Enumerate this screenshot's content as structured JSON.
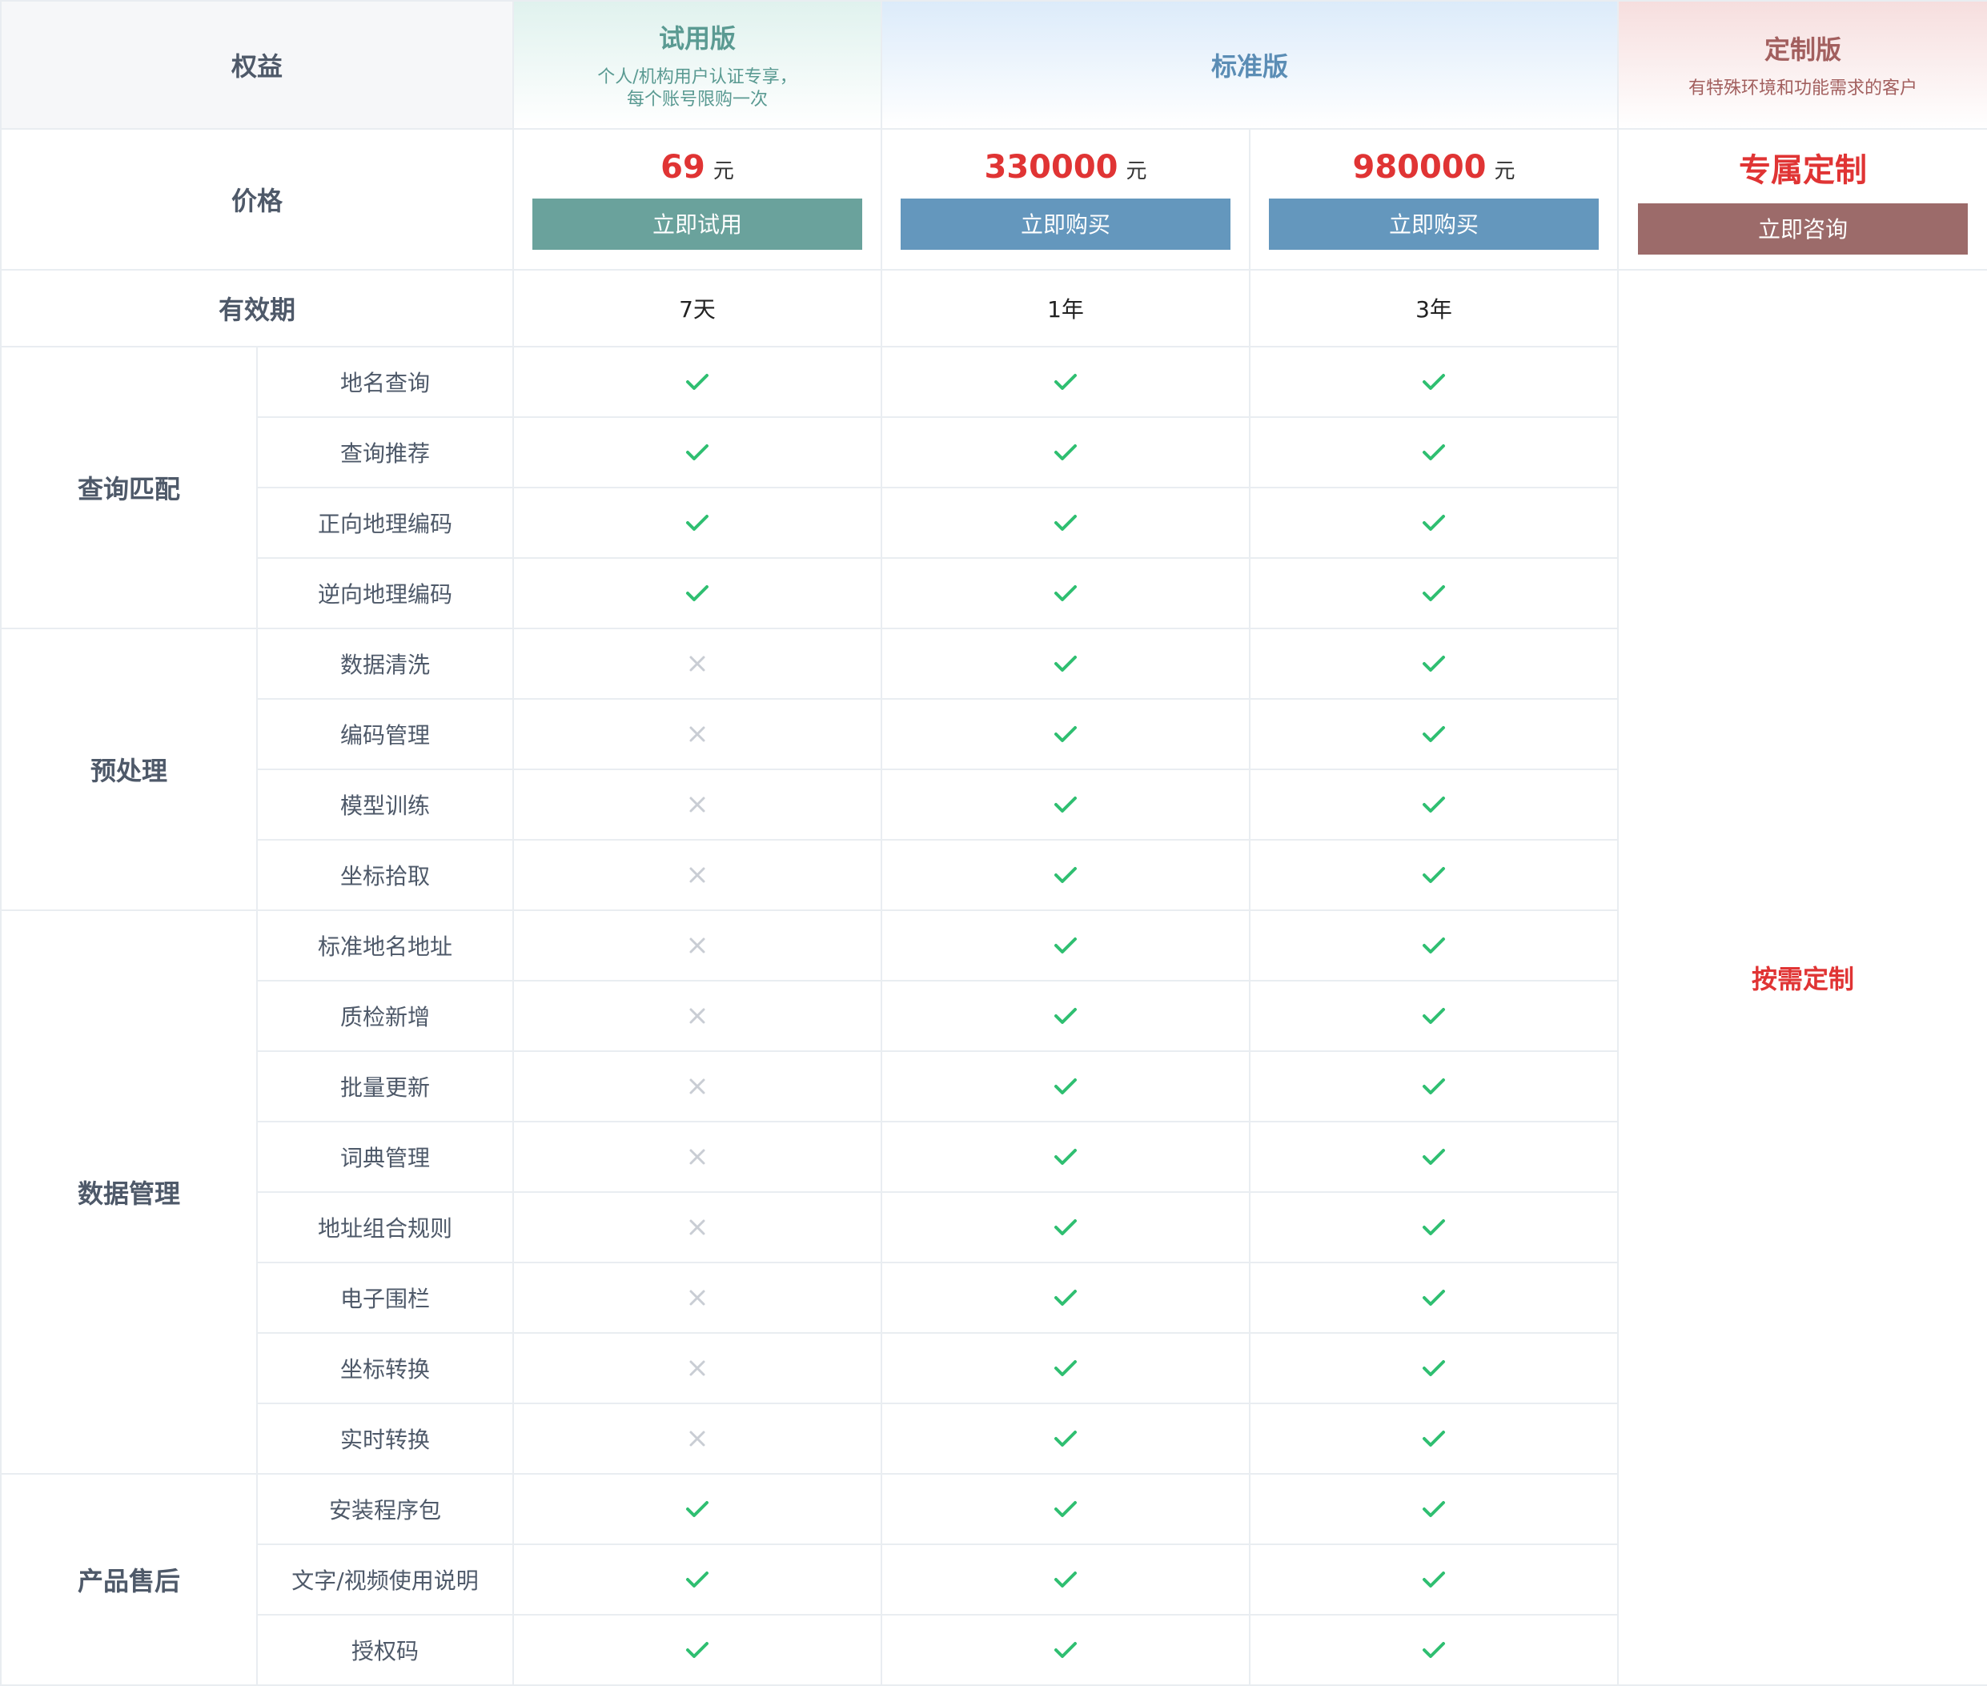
{
  "header": {
    "rights_label": "权益",
    "trial": {
      "name": "试用版",
      "desc": "个人/机构用户认证专享，\n每个账号限购一次"
    },
    "standard": {
      "name": "标准版"
    },
    "custom": {
      "name": "定制版",
      "desc": "有特殊环境和功能需求的客户"
    }
  },
  "price_row": {
    "label": "价格",
    "trial": {
      "amount": "69",
      "unit": "元",
      "button": "立即试用"
    },
    "standard_1": {
      "amount": "330000",
      "unit": "元",
      "button": "立即购买"
    },
    "standard_2": {
      "amount": "980000",
      "unit": "元",
      "button": "立即购买"
    },
    "custom": {
      "amount": "专属定制",
      "button": "立即咨询"
    }
  },
  "validity_row": {
    "label": "有效期",
    "trial": "7天",
    "standard_1": "1年",
    "standard_2": "3年"
  },
  "custom_note": "按需定制",
  "colors": {
    "check": "#2fbf71",
    "cross": "#c9cdd4",
    "price_red": "#e03434",
    "trial_button": "#6aa29c",
    "standard_button": "#6497bd",
    "custom_button": "#9c6b6a"
  },
  "categories": [
    {
      "name": "查询匹配",
      "features": [
        {
          "name": "地名查询",
          "trial": true,
          "standard_1": true,
          "standard_2": true
        },
        {
          "name": "查询推荐",
          "trial": true,
          "standard_1": true,
          "standard_2": true
        },
        {
          "name": "正向地理编码",
          "trial": true,
          "standard_1": true,
          "standard_2": true
        },
        {
          "name": "逆向地理编码",
          "trial": true,
          "standard_1": true,
          "standard_2": true
        }
      ]
    },
    {
      "name": "预处理",
      "features": [
        {
          "name": "数据清洗",
          "trial": false,
          "standard_1": true,
          "standard_2": true
        },
        {
          "name": "编码管理",
          "trial": false,
          "standard_1": true,
          "standard_2": true
        },
        {
          "name": "模型训练",
          "trial": false,
          "standard_1": true,
          "standard_2": true
        },
        {
          "name": "坐标拾取",
          "trial": false,
          "standard_1": true,
          "standard_2": true
        }
      ]
    },
    {
      "name": "数据管理",
      "features": [
        {
          "name": "标准地名地址",
          "trial": false,
          "standard_1": true,
          "standard_2": true
        },
        {
          "name": "质检新增",
          "trial": false,
          "standard_1": true,
          "standard_2": true
        },
        {
          "name": "批量更新",
          "trial": false,
          "standard_1": true,
          "standard_2": true
        },
        {
          "name": "词典管理",
          "trial": false,
          "standard_1": true,
          "standard_2": true
        },
        {
          "name": "地址组合规则",
          "trial": false,
          "standard_1": true,
          "standard_2": true
        },
        {
          "name": "电子围栏",
          "trial": false,
          "standard_1": true,
          "standard_2": true
        },
        {
          "name": "坐标转换",
          "trial": false,
          "standard_1": true,
          "standard_2": true
        },
        {
          "name": "实时转换",
          "trial": false,
          "standard_1": true,
          "standard_2": true
        }
      ]
    },
    {
      "name": "产品售后",
      "features": [
        {
          "name": "安装程序包",
          "trial": true,
          "standard_1": true,
          "standard_2": true
        },
        {
          "name": "文字/视频使用说明",
          "trial": true,
          "standard_1": true,
          "standard_2": true
        },
        {
          "name": "授权码",
          "trial": true,
          "standard_1": true,
          "standard_2": true
        }
      ]
    }
  ]
}
